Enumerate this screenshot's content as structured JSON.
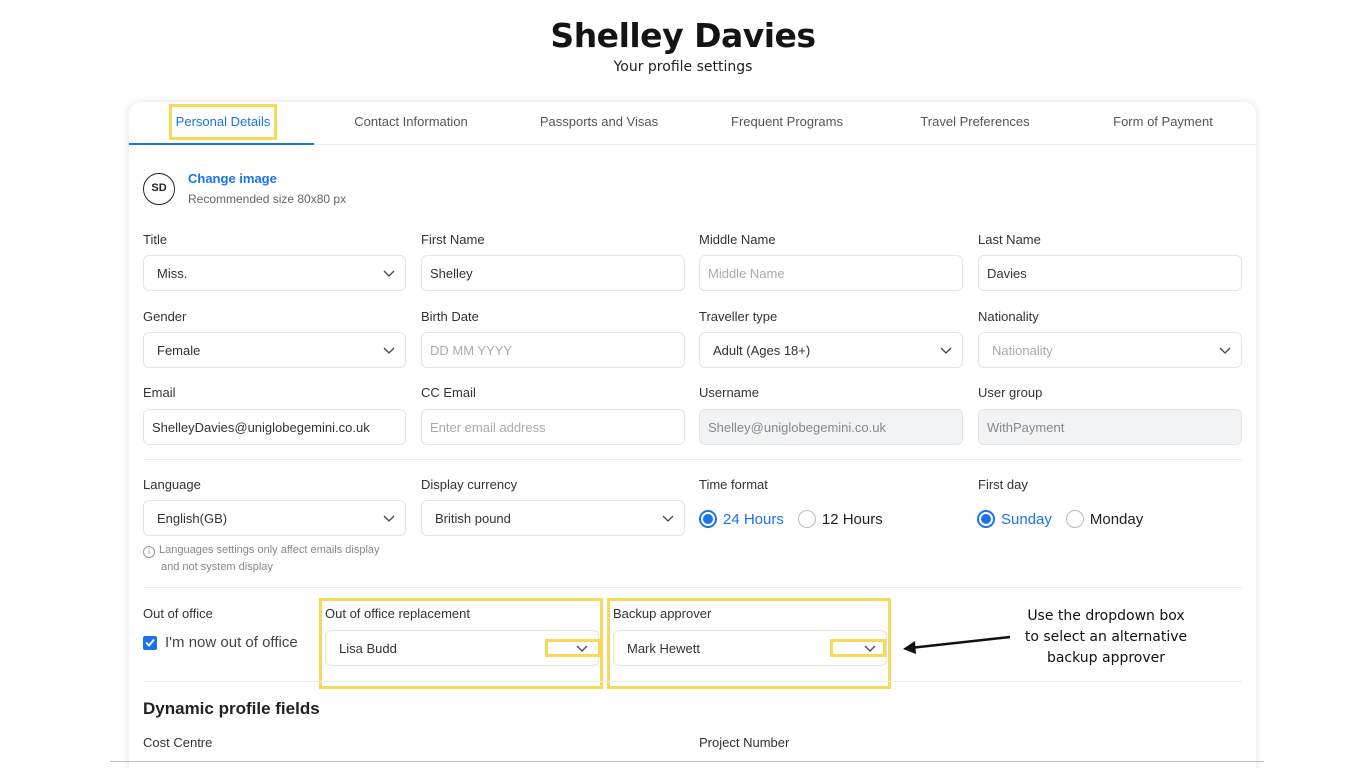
{
  "header": {
    "name": "Shelley Davies",
    "subtitle": "Your profile settings"
  },
  "tabs": [
    {
      "label": "Personal Details",
      "active": true
    },
    {
      "label": "Contact Information"
    },
    {
      "label": "Passports and Visas"
    },
    {
      "label": "Frequent Programs"
    },
    {
      "label": "Travel Preferences"
    },
    {
      "label": "Form of Payment"
    }
  ],
  "profile_image": {
    "initials": "SD",
    "change_label": "Change image",
    "recommended": "Recommended size 80x80 px"
  },
  "fields": {
    "title": {
      "label": "Title",
      "value": "Miss."
    },
    "first_name": {
      "label": "First Name",
      "value": "Shelley"
    },
    "middle_name": {
      "label": "Middle Name",
      "placeholder": "Middle Name"
    },
    "last_name": {
      "label": "Last Name",
      "value": "Davies"
    },
    "gender": {
      "label": "Gender",
      "value": "Female"
    },
    "birth_date": {
      "label": "Birth Date",
      "placeholder": "DD MM YYYY"
    },
    "traveller_type": {
      "label": "Traveller type",
      "value": "Adult (Ages 18+)"
    },
    "nationality": {
      "label": "Nationality",
      "placeholder": "Nationality"
    },
    "email": {
      "label": "Email",
      "value": "ShelleyDavies@uniglobegemini.co.uk"
    },
    "cc_email": {
      "label": "CC Email",
      "placeholder": "Enter email address"
    },
    "username": {
      "label": "Username",
      "value": "Shelley@uniglobegemini.co.uk"
    },
    "user_group": {
      "label": "User group",
      "value": "WithPayment"
    }
  },
  "settings": {
    "language": {
      "label": "Language",
      "value": "English(GB)"
    },
    "language_note_line1": "Languages settings only affect emails display",
    "language_note_line2": "and not system display",
    "display_currency": {
      "label": "Display currency",
      "value": "British pound"
    },
    "time_format": {
      "label": "Time format",
      "options": [
        "24 Hours",
        "12 Hours"
      ],
      "selected": "24 Hours"
    },
    "first_day": {
      "label": "First day",
      "options": [
        "Sunday",
        "Monday"
      ],
      "selected": "Sunday"
    }
  },
  "out_of_office": {
    "label": "Out of office",
    "checkbox_label": "I'm now out of office",
    "checked": true,
    "replacement_label": "Out of office replacement",
    "replacement_value": "Lisa Budd",
    "backup_label": "Backup approver",
    "backup_value": "Mark Hewett"
  },
  "dynamic": {
    "title": "Dynamic profile fields",
    "cost_centre_label": "Cost Centre",
    "project_number_label": "Project Number"
  },
  "annotation": {
    "line1": "Use the dropdown box",
    "line2": "to select an alternative",
    "line3": "backup approver"
  },
  "colors": {
    "accent": "#1a73e8",
    "highlight": "#f7d858"
  }
}
